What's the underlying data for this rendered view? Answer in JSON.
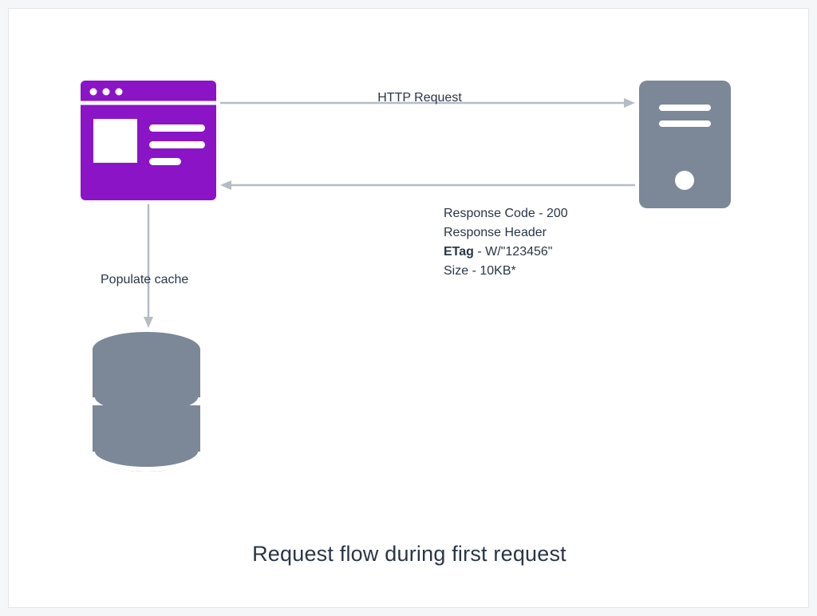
{
  "title": "Request flow during first request",
  "labels": {
    "http_request": "HTTP Request",
    "populate_cache": "Populate cache"
  },
  "response": {
    "code_label": "Response Code",
    "code_value": "200",
    "header_label": "Response Header",
    "etag_label": "ETag",
    "etag_value": "W/\"123456\"",
    "size_label": "Size",
    "size_value": "10KB*"
  },
  "icons": {
    "browser": "browser-window",
    "server": "server-tower",
    "database": "database-cylinder"
  },
  "colors": {
    "browser": "#8a14c6",
    "server": "#7c8797",
    "database": "#7c8797",
    "arrow": "#b6bcc6",
    "text": "#2a3646"
  }
}
